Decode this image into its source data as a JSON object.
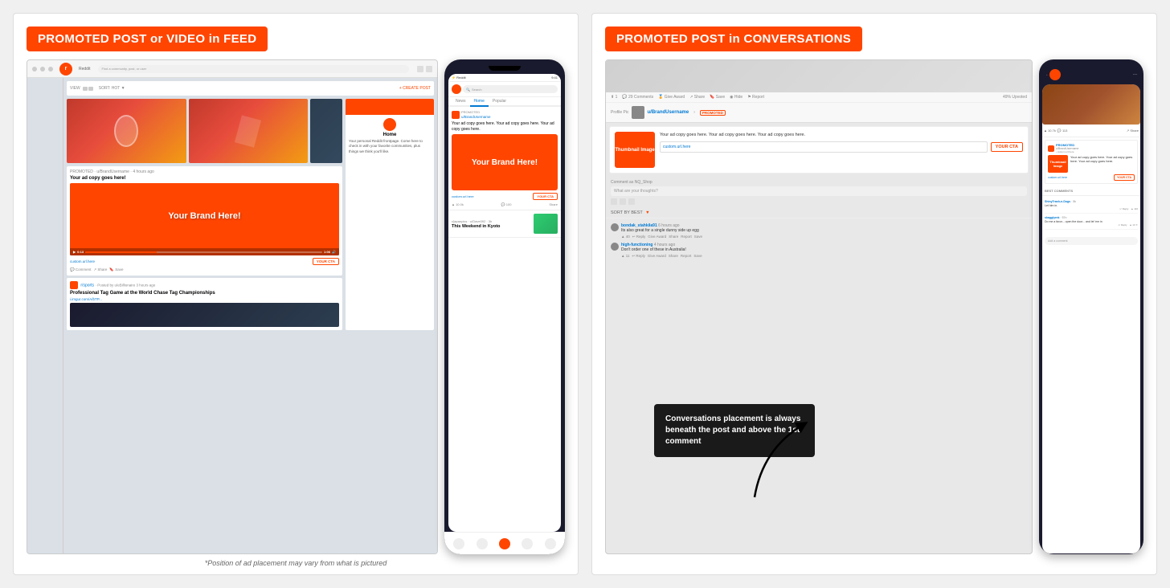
{
  "left_panel": {
    "header": "PROMOTED POST or VIDEO in FEED",
    "footnote": "*Position of ad placement may vary from what is pictured",
    "desktop": {
      "promoted_label": "PROMOTED · u/BrandUsername · 4 hours ago",
      "ad_copy": "Your ad copy goes here!",
      "brand_text": "Your Brand Here!",
      "url": "custom.url.here",
      "cta": "YOUR CTA",
      "post_title": "Professional Tag Game at the World Chase Tag Championships",
      "post_link": "i.imgur.com/A/bTP...",
      "widget_title": "Home",
      "widget_text": "Your personal Reddit frontpage. Come here to check in with your favorite communities, plus things we think you'll like."
    },
    "phone": {
      "promoted_label": "PROMOTED",
      "username": "u/BrandUsername",
      "ad_copy": "Your ad copy goes here. Your ad copy goes here. Your ad copy goes here.",
      "brand_text": "Your Brand Here!",
      "url": "custom.url.here",
      "cta": "YOUR CTA",
      "search_placeholder": "Search",
      "tabs": [
        "News",
        "Home",
        "Popular"
      ],
      "active_tab": "Home",
      "post_share": "Share",
      "stats_votes": "10.0k",
      "stats_comments": "100",
      "next_post": "This Weekend in Kyoto"
    }
  },
  "right_panel": {
    "header": "PROMOTED POST in CONVERSATIONS",
    "callout_text": "Conversations placement is always beneath the post and above the 1st comment",
    "desktop": {
      "username": "u/BrandUsername",
      "promoted_badge": "PROMOTED",
      "thumbnail_label": "Thumbnail Image",
      "ad_copy": "Your ad copy goes here. Your ad copy goes here. Your ad copy goes here.",
      "url": "custom.url.here",
      "cta": "YOUR CTA",
      "comment_placeholder": "Comment as NQ_Shop",
      "thoughts_placeholder": "What are your thoughts?",
      "sort_label": "SORT BY BEST",
      "comments": [
        {
          "user": "bondak_stahkila91",
          "time": "6 hours ago",
          "text": "Its also great for a single dunny side up egg",
          "votes": "40"
        },
        {
          "user": "high-functioning",
          "time": "4 hours ago",
          "text": "Don't order one of these in Australia!",
          "votes": "11"
        }
      ]
    },
    "phone": {
      "username": "u/BrandUsername",
      "promoted_label": "PROMOTED",
      "ad_copy": "Your ad copy goes here. Your ad copy goes here. Your ad copy goes here.",
      "thumbnail_label": "Thumbnail Image",
      "url": "custom.url.here",
      "cta": "YOUR CTA",
      "comments_label": "BEST COMMENTS",
      "comments": [
        {
          "user": "ShinyTrash-n-Dogs",
          "text": "Let him in."
        },
        {
          "user": "skagglyrnk",
          "text": "Do me a favor... open the door... and let 'em in"
        }
      ],
      "add_comment": "Add a comment"
    }
  }
}
